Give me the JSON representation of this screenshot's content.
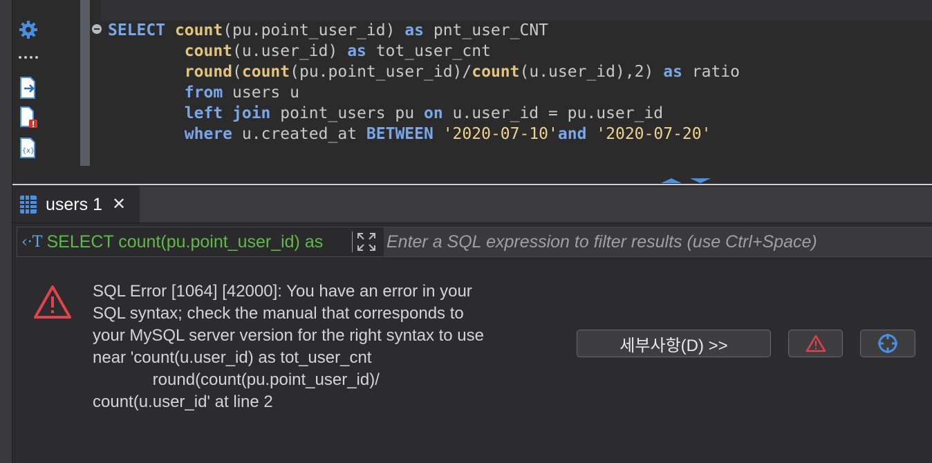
{
  "editor": {
    "sidebar_icons": [
      "gear-icon",
      "dots-icon",
      "export-icon",
      "file-error-icon",
      "variables-icon"
    ],
    "code_lines": [
      [
        {
          "t": "kw",
          "v": "SELECT "
        },
        {
          "t": "fn",
          "v": "count"
        },
        {
          "t": "tx",
          "v": "(pu.point_user_id) "
        },
        {
          "t": "kw",
          "v": "as"
        },
        {
          "t": "tx",
          "v": " pnt_user_CNT"
        }
      ],
      [
        {
          "t": "tx",
          "v": "        "
        },
        {
          "t": "fn",
          "v": "count"
        },
        {
          "t": "tx",
          "v": "(u.user_id) "
        },
        {
          "t": "kw",
          "v": "as"
        },
        {
          "t": "tx",
          "v": " tot_user_cnt"
        }
      ],
      [
        {
          "t": "tx",
          "v": "        "
        },
        {
          "t": "fn",
          "v": "round"
        },
        {
          "t": "tx",
          "v": "("
        },
        {
          "t": "fn",
          "v": "count"
        },
        {
          "t": "tx",
          "v": "(pu.point_user_id)/"
        },
        {
          "t": "fn",
          "v": "count"
        },
        {
          "t": "tx",
          "v": "(u.user_id),2) "
        },
        {
          "t": "kw",
          "v": "as"
        },
        {
          "t": "tx",
          "v": " ratio"
        }
      ],
      [
        {
          "t": "tx",
          "v": "        "
        },
        {
          "t": "kw",
          "v": "from"
        },
        {
          "t": "tx",
          "v": " users u"
        }
      ],
      [
        {
          "t": "tx",
          "v": "        "
        },
        {
          "t": "kw",
          "v": "left join"
        },
        {
          "t": "tx",
          "v": " point_users pu "
        },
        {
          "t": "kw",
          "v": "on"
        },
        {
          "t": "tx",
          "v": " u.user_id = pu.user_id"
        }
      ],
      [
        {
          "t": "tx",
          "v": "        "
        },
        {
          "t": "kw",
          "v": "where"
        },
        {
          "t": "tx",
          "v": " u.created_at "
        },
        {
          "t": "kw",
          "v": "BETWEEN"
        },
        {
          "t": "tx",
          "v": " "
        },
        {
          "t": "str",
          "v": "'2020-07-10'"
        },
        {
          "t": "kw",
          "v": "and"
        },
        {
          "t": "tx",
          "v": " "
        },
        {
          "t": "str",
          "v": "'2020-07-20'"
        }
      ]
    ]
  },
  "results": {
    "tab_label": "users 1",
    "tab_close": "✕",
    "filter_icon": "‹·T",
    "filter_query": "SELECT count(pu.point_user_id) as",
    "filter_placeholder": "Enter a SQL expression to filter results (use Ctrl+Space)"
  },
  "error": {
    "message": "SQL Error [1064] [42000]: You have an error in your\nSQL syntax; check the manual that corresponds to\nyour MySQL server version for the right syntax to use\nnear 'count(u.user_id) as tot_user_cnt\n             round(count(pu.point_user_id)/\ncount(u.user_id' at line 2",
    "details_button": "세부사항(D) >>"
  },
  "colors": {
    "keyword": "#7aa6ea",
    "function": "#e3c47d",
    "string": "#f0d28a",
    "query_text": "#5fba47",
    "error_red": "#e0434c",
    "accent_blue": "#4a90e2"
  }
}
